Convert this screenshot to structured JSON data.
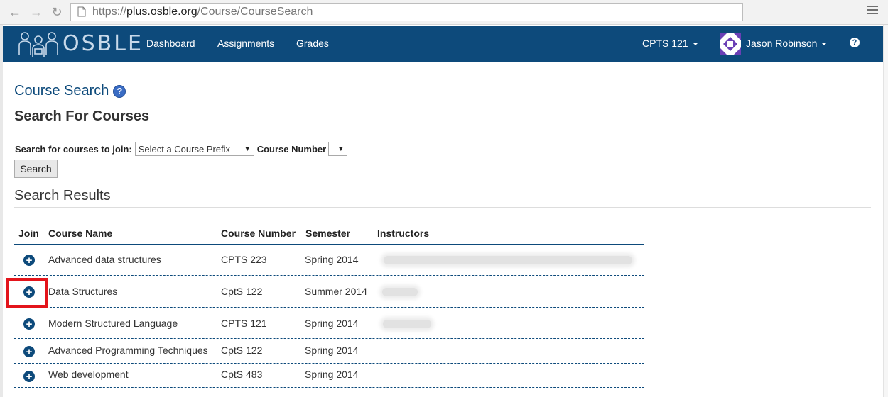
{
  "browser": {
    "url_scheme": "https://",
    "url_host": "plus.osble.org",
    "url_path": "/Course/CourseSearch"
  },
  "navbar": {
    "logo_text": "OSBLE",
    "links": [
      "Dashboard",
      "Assignments",
      "Grades"
    ],
    "course_menu": "CPTS 121",
    "user_menu": "Jason Robinson",
    "help": "?"
  },
  "page": {
    "title": "Course Search",
    "help_icon": "?",
    "search_heading": "Search For Courses",
    "search_label": "Search for courses to join:",
    "prefix_select": "Select a Course Prefix",
    "number_label": "Course Number",
    "number_select": "",
    "search_button": "Search",
    "results_heading": "Search Results"
  },
  "results": {
    "columns": [
      "Join",
      "Course Name",
      "Course Number",
      "Semester",
      "Instructors"
    ],
    "rows": [
      {
        "name": "Advanced data structures",
        "number": "CPTS 223",
        "semester": "Spring 2014"
      },
      {
        "name": "Data Structures",
        "number": "CptS 122",
        "semester": "Summer 2014"
      },
      {
        "name": "Modern Structured Language",
        "number": "CPTS 121",
        "semester": "Spring 2014"
      },
      {
        "name": "Advanced Programming Techniques",
        "number": "CptS 122",
        "semester": "Spring 2014"
      },
      {
        "name": "Web development",
        "number": "CptS 483",
        "semester": "Spring 2014"
      }
    ]
  },
  "colors": {
    "navbar": "#0d4a7b",
    "highlight": "#e3141b"
  }
}
